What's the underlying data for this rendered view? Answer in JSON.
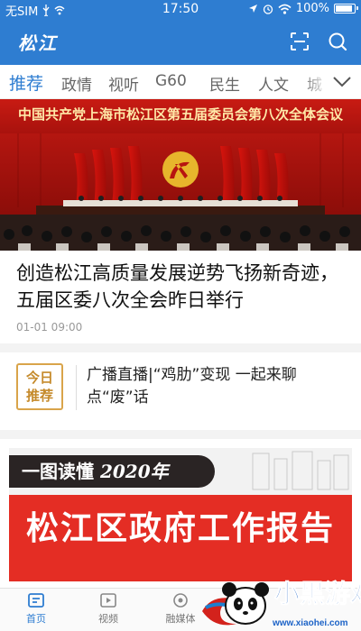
{
  "status_bar": {
    "carrier": "无SIM",
    "time": "17:50",
    "battery": "100%",
    "battery_level": 1.0
  },
  "header": {
    "logo": "松江",
    "scan_icon": "scan-icon",
    "search_icon": "search-icon"
  },
  "tabs": [
    {
      "label": "推荐",
      "active": true
    },
    {
      "label": "政情",
      "active": false
    },
    {
      "label": "视听",
      "active": false
    },
    {
      "label": "G60",
      "active": false
    },
    {
      "label": "民生",
      "active": false
    },
    {
      "label": "人文",
      "active": false
    },
    {
      "label": "城",
      "active": false
    }
  ],
  "tabs_more_icon": "chevron-down-icon",
  "hero": {
    "banner_text": "中国共产党上海市松江区第五届委员会第八次全体会议"
  },
  "article": {
    "title": "创造松江高质量发展逆势飞扬新奇迹，五届区委八次全会昨日举行",
    "time": "01-01 09:00"
  },
  "today": {
    "badge_line1": "今日",
    "badge_line2": "推荐",
    "text": "广播直播|“鸡肋”变现  一起来聊点“废”话"
  },
  "report": {
    "pill_prefix": "一图读懂",
    "pill_year": "2020年",
    "main_text": "松江区政府工作报告"
  },
  "bottom_nav": [
    {
      "label": "首页",
      "icon": "home-icon",
      "active": true
    },
    {
      "label": "视频",
      "icon": "video-icon",
      "active": false
    },
    {
      "label": "融媒体",
      "icon": "media-icon",
      "active": false
    }
  ],
  "watermark": {
    "title": "小黑游戏",
    "url": "www.xiaohei.com"
  },
  "colors": {
    "brand_blue": "#2e7dd1",
    "banner_red": "#c81b13",
    "badge_gold": "#d9a44a"
  }
}
